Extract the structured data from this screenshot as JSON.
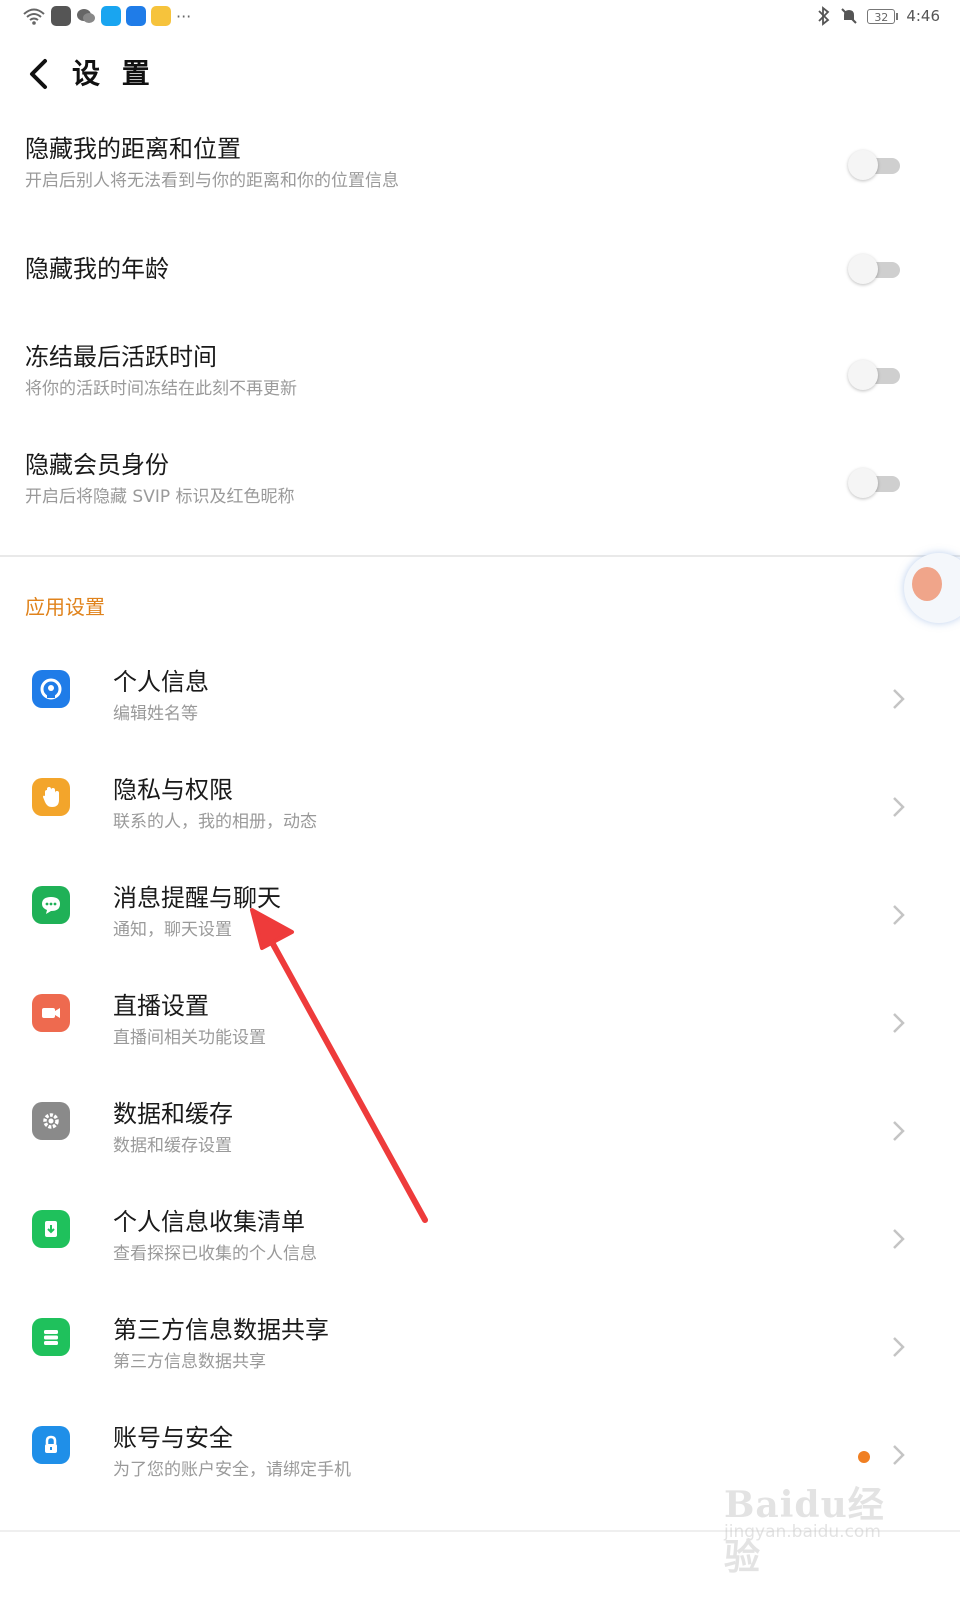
{
  "status_bar": {
    "time": "4:46",
    "battery": "32",
    "overflow_dots": "···"
  },
  "header": {
    "title": "设 置"
  },
  "privacy_toggles": [
    {
      "title": "隐藏我的距离和位置",
      "subtitle": "开启后别人将无法看到与你的距离和你的位置信息",
      "on": false
    },
    {
      "title": "隐藏我的年龄",
      "subtitle": "",
      "on": false
    },
    {
      "title": "冻结最后活跃时间",
      "subtitle": "将你的活跃时间冻结在此刻不再更新",
      "on": false
    },
    {
      "title": "隐藏会员身份",
      "subtitle": "开启后将隐藏 SVIP 标识及红色昵称",
      "on": false
    }
  ],
  "app_settings": {
    "header": "应用设置",
    "items": [
      {
        "title": "个人信息",
        "subtitle": "编辑姓名等",
        "icon": "person-icon",
        "color": "#1f7ce8"
      },
      {
        "title": "隐私与权限",
        "subtitle": "联系的人，我的相册，动态",
        "icon": "hand-icon",
        "color": "#f3a52b"
      },
      {
        "title": "消息提醒与聊天",
        "subtitle": "通知，聊天设置",
        "icon": "chat-icon",
        "color": "#1fb157"
      },
      {
        "title": "直播设置",
        "subtitle": "直播间相关功能设置",
        "icon": "video-icon",
        "color": "#ee6a4f"
      },
      {
        "title": "数据和缓存",
        "subtitle": "数据和缓存设置",
        "icon": "gear-icon",
        "color": "#8a8a8a"
      },
      {
        "title": "个人信息收集清单",
        "subtitle": "查看探探已收集的个人信息",
        "icon": "download-icon",
        "color": "#1fc15c"
      },
      {
        "title": "第三方信息数据共享",
        "subtitle": "第三方信息数据共享",
        "icon": "list-icon",
        "color": "#1fc15c"
      },
      {
        "title": "账号与安全",
        "subtitle": "为了您的账户安全，请绑定手机",
        "icon": "lock-icon",
        "color": "#1f8fe8",
        "badge": true
      }
    ]
  },
  "watermark": {
    "brand": "Baidu经验",
    "url": "jingyan.baidu.com"
  },
  "annotation_color": "#ee3b3b"
}
